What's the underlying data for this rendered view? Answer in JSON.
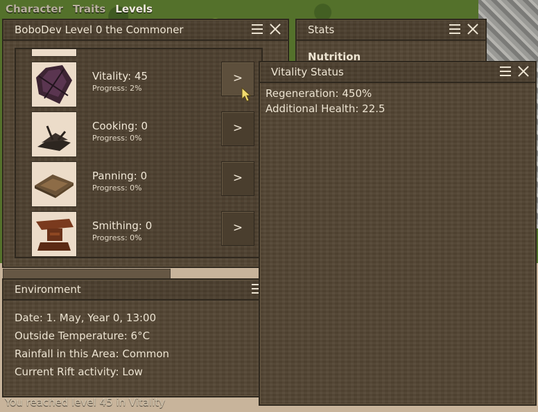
{
  "tabs": [
    {
      "label": "Character",
      "active": false
    },
    {
      "label": "Traits",
      "active": false
    },
    {
      "label": "Levels",
      "active": true
    }
  ],
  "levels_panel": {
    "title": "BoboDev Level 0 the Commoner",
    "go_label": ">",
    "skills": [
      {
        "name": "Vitality: 45",
        "progress": "Progress: 2%",
        "icon": "vitality-icon"
      },
      {
        "name": "Cooking: 0",
        "progress": "Progress: 0%",
        "icon": "cooking-icon"
      },
      {
        "name": "Panning: 0",
        "progress": "Progress: 0%",
        "icon": "panning-icon"
      },
      {
        "name": "Smithing: 0",
        "progress": "Progress: 0%",
        "icon": "smithing-icon"
      }
    ]
  },
  "stats_panel": {
    "title": "Stats",
    "heading": "Nutrition"
  },
  "vitality_panel": {
    "title": "Vitality Status",
    "lines": [
      "Regeneration: 450%",
      "Additional Health: 22.5"
    ]
  },
  "environment_panel": {
    "title": "Environment",
    "lines": [
      "Date: 1. May, Year 0, 13:00",
      "Outside Temperature: 6°C",
      "Rainfall in this Area: Common",
      "Current Rift activity: Low"
    ]
  },
  "status_message": "You reached level 45 in Vitality"
}
